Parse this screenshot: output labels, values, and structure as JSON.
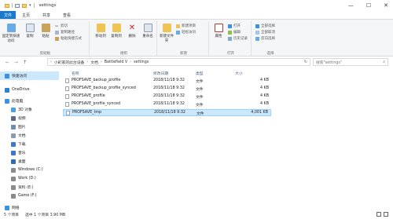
{
  "window": {
    "title": "settings",
    "controls": {
      "minimize": "—",
      "maximize": "☐",
      "close": "✕"
    }
  },
  "ribbon_tabs": [
    "文件",
    "主页",
    "共享",
    "查看"
  ],
  "ribbon": {
    "clipboard": {
      "group_label": "剪贴板",
      "pin": "固定到快速访问",
      "copy": "复制",
      "paste": "粘贴",
      "cut": "剪切",
      "copy_path": "复制路径",
      "paste_shortcut": "粘贴快捷方式"
    },
    "organize": {
      "group_label": "组织",
      "move_to": "移动到",
      "copy_to": "复制到",
      "delete": "删除",
      "rename": "重命名"
    },
    "new": {
      "group_label": "新建",
      "new_folder": "新建文件夹",
      "new_item": "新建项目",
      "easy_access": "轻松访问"
    },
    "open": {
      "group_label": "打开",
      "properties": "属性",
      "open": "打开",
      "edit": "编辑",
      "history": "历史记录"
    },
    "select": {
      "group_label": "选择",
      "select_all": "全部选择",
      "select_none": "全部取消",
      "invert": "反向选择"
    }
  },
  "nav": {
    "back": "←",
    "forward": "→",
    "up": "↑"
  },
  "address": {
    "crumbs": [
      "小町家的此台设备",
      "文档",
      "Battlefield V",
      "settings"
    ],
    "search_placeholder": "搜索\"settings\""
  },
  "nav_pane": [
    {
      "label": "快速访问",
      "indent": 0,
      "selected": true,
      "color": "#3d8fe0"
    },
    {
      "label": "OneDrive",
      "indent": 0,
      "selected": false,
      "color": "#2d7fd3"
    },
    {
      "label": "此电脑",
      "indent": 0,
      "selected": false,
      "color": "#3c91e6"
    },
    {
      "label": "3D 对象",
      "indent": 1,
      "selected": false,
      "color": "#4aa3e0"
    },
    {
      "label": "视频",
      "indent": 1,
      "selected": false,
      "color": "#5a6b85"
    },
    {
      "label": "图片",
      "indent": 1,
      "selected": false,
      "color": "#6b8fb3"
    },
    {
      "label": "文档",
      "indent": 1,
      "selected": false,
      "color": "#8a9bb1"
    },
    {
      "label": "下载",
      "indent": 1,
      "selected": false,
      "color": "#3a78c9"
    },
    {
      "label": "音乐",
      "indent": 1,
      "selected": false,
      "color": "#3a78c9"
    },
    {
      "label": "桌面",
      "indent": 1,
      "selected": false,
      "color": "#2e6db5"
    },
    {
      "label": "Windows (C:)",
      "indent": 1,
      "selected": false,
      "color": "#8a8a8a"
    },
    {
      "label": "Work (D:)",
      "indent": 1,
      "selected": false,
      "color": "#8a8a8a"
    },
    {
      "label": "资料 (E:)",
      "indent": 1,
      "selected": false,
      "color": "#8a8a8a"
    },
    {
      "label": "Game (F:)",
      "indent": 1,
      "selected": false,
      "color": "#8a8a8a"
    },
    {
      "label": "网络",
      "indent": 0,
      "selected": false,
      "color": "#3c91e6"
    }
  ],
  "columns": {
    "name": "名称",
    "date": "修改日期",
    "type": "类型",
    "size": "大小"
  },
  "files": [
    {
      "name": "PROFSAVE_backup_profile",
      "date": "2018/11/18 9:32",
      "type": "文件",
      "size": "4 KB",
      "selected": false
    },
    {
      "name": "PROFSAVE_backup_profile_synced",
      "date": "2018/11/18 9:32",
      "type": "文件",
      "size": "4 KB",
      "selected": false
    },
    {
      "name": "PROFSAVE_profile",
      "date": "2018/11/18 9:32",
      "type": "文件",
      "size": "4 KB",
      "selected": false
    },
    {
      "name": "PROFSAVE_profile_synced",
      "date": "2018/11/18 9:32",
      "type": "文件",
      "size": "4 KB",
      "selected": false
    },
    {
      "name": "PROFSAVE_tmp",
      "date": "2018/11/18 9:32",
      "type": "文件",
      "size": "4,001 KB",
      "selected": true
    }
  ],
  "status": {
    "count": "5 个项目",
    "selection": "选中 1 个项目  3.90 MB"
  }
}
